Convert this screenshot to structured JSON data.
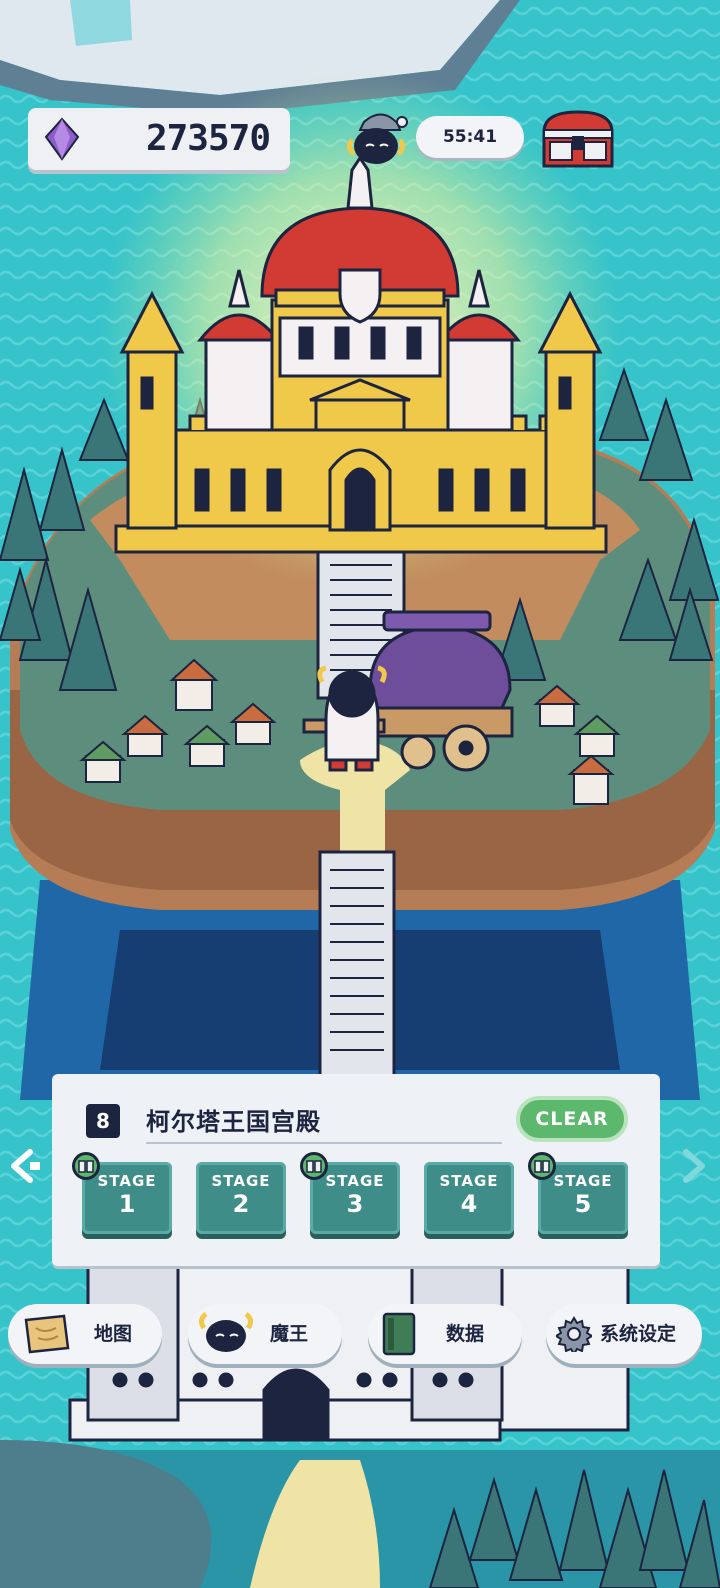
{
  "hud": {
    "gems": "273570",
    "timer": "55:41"
  },
  "level": {
    "number": "8",
    "title": "柯尔塔王国宫殿",
    "status": "CLEAR",
    "stages": [
      {
        "label": "STAGE",
        "number": "1",
        "has_book": true
      },
      {
        "label": "STAGE",
        "number": "2",
        "has_book": false
      },
      {
        "label": "STAGE",
        "number": "3",
        "has_book": true
      },
      {
        "label": "STAGE",
        "number": "4",
        "has_book": false
      },
      {
        "label": "STAGE",
        "number": "5",
        "has_book": true
      }
    ]
  },
  "nav": {
    "map": "地图",
    "demon_king": "魔王",
    "data": "数据",
    "settings": "系统设定"
  },
  "icons": {
    "gem": "purple-crystal-icon",
    "chest": "treasure-chest-icon",
    "map": "scroll-map-icon",
    "demon": "demon-king-avatar-icon",
    "book": "green-book-icon",
    "gear": "gear-icon",
    "arrow_left": "arrow-left-icon",
    "arrow_right": "arrow-right-icon"
  },
  "colors": {
    "sea": "#36c3c9",
    "ink": "#1d2440",
    "stage_button": "#3f8d88",
    "clear_green": "#5cb86c",
    "castle_gold": "#f1c94a",
    "roof_red": "#d23a34"
  }
}
